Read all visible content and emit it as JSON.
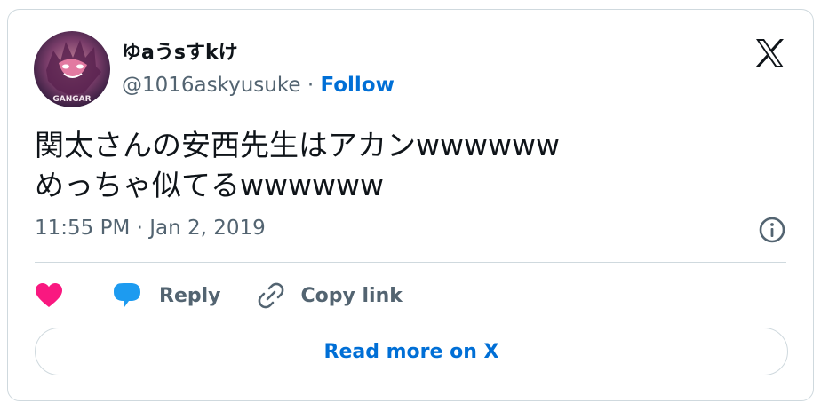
{
  "author": {
    "display_name": "ゆaうsすkけ",
    "handle": "@1016askyusuke",
    "separator": " · ",
    "follow_label": "Follow",
    "avatar_text": "GANGAR"
  },
  "tweet": {
    "lines": [
      "関太さんの安西先生はアカンwwwwww",
      "めっちゃ似てるwwwwww"
    ],
    "timestamp": "11:55 PM · Jan 2, 2019"
  },
  "actions": {
    "reply_label": "Reply",
    "copy_label": "Copy link"
  },
  "read_more_label": "Read more on X",
  "icons": {
    "logo": "x-logo-icon",
    "info": "info-icon",
    "like": "heart-icon",
    "reply": "speech-bubble-icon",
    "copy": "link-icon"
  },
  "colors": {
    "link": "#006fd6",
    "heart": "#f91880",
    "reply": "#1d9bf0",
    "secondary_text": "#536471",
    "border": "#cfd9de"
  }
}
